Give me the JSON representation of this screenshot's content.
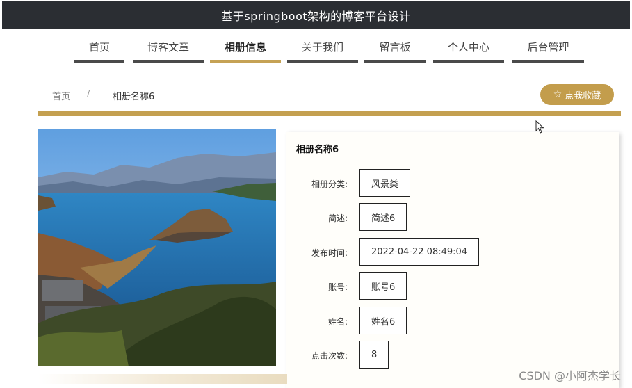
{
  "header": {
    "title": "基于springboot架构的博客平台设计"
  },
  "nav": {
    "items": [
      {
        "label": "首页",
        "active": false
      },
      {
        "label": "博客文章",
        "active": false
      },
      {
        "label": "相册信息",
        "active": true
      },
      {
        "label": "关于我们",
        "active": false
      },
      {
        "label": "留言板",
        "active": false
      },
      {
        "label": "个人中心",
        "active": false
      },
      {
        "label": "后台管理",
        "active": false
      }
    ]
  },
  "breadcrumb": {
    "home": "首页",
    "separator": "/",
    "current": "相册名称6"
  },
  "favorite_button": {
    "icon": "star-outline-icon",
    "label": "点我收藏"
  },
  "album": {
    "title": "相册名称6",
    "fields": [
      {
        "label": "相册分类:",
        "value": "风景类"
      },
      {
        "label": "简述:",
        "value": "简述6"
      },
      {
        "label": "发布时间:",
        "value": "2022-04-22 08:49:04"
      },
      {
        "label": "账号:",
        "value": "账号6"
      },
      {
        "label": "姓名:",
        "value": "姓名6"
      },
      {
        "label": "点击次数:",
        "value": "8"
      }
    ]
  },
  "watermark": "CSDN @小阿杰学长",
  "colors": {
    "accent": "#c39d4c",
    "header_bg": "#2b2e33",
    "nav_underline": "#4a4a4a"
  }
}
